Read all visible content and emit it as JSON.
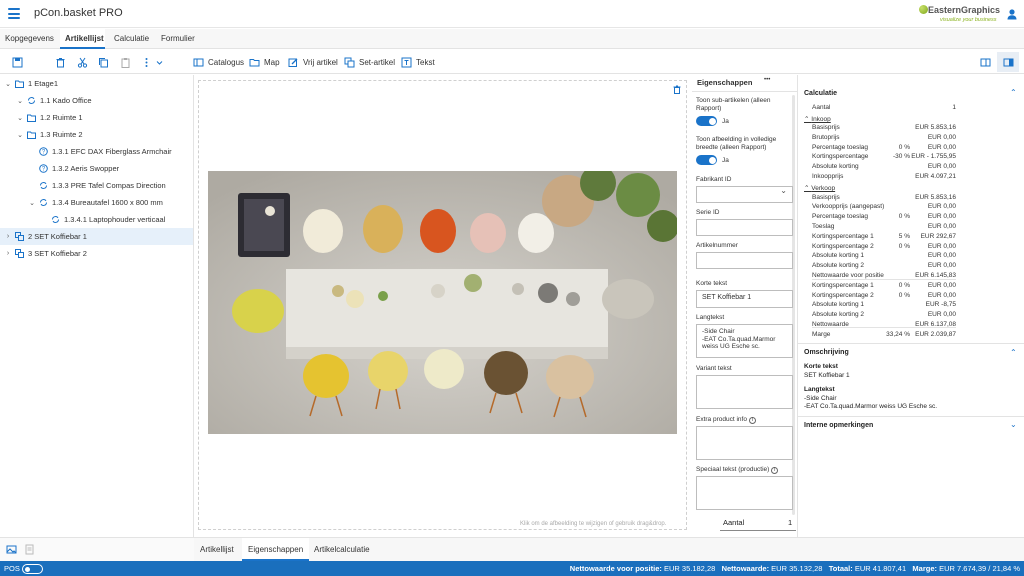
{
  "app": {
    "title": "pCon.basket PRO",
    "logo_brand": "EasternGraphics",
    "logo_tagline": "visualize your business"
  },
  "tabs": [
    "Kopgegevens",
    "Artikellijst",
    "Calculatie",
    "Formulier"
  ],
  "toolbar": {
    "catalogus": "Catalogus",
    "map": "Map",
    "vrij_artikel": "Vrij artikel",
    "set_artikel": "Set-artikel",
    "tekst": "Tekst"
  },
  "tree": [
    {
      "label": "1 Etage1"
    },
    {
      "label": "1.1 Kado Office"
    },
    {
      "label": "1.2 Ruimte 1"
    },
    {
      "label": "1.3 Ruimte 2"
    },
    {
      "label": "1.3.1 EFC DAX Fiberglass Armchair"
    },
    {
      "label": "1.3.2 Aeris Swopper"
    },
    {
      "label": "1.3.3 PRE Tafel Compas Direction"
    },
    {
      "label": "1.3.4 Bureautafel 1600 x 800 mm"
    },
    {
      "label": "1.3.4.1 Laptophouder verticaal"
    },
    {
      "label": "2 SET Koffiebar 1"
    },
    {
      "label": "3 SET Koffiebar 2"
    }
  ],
  "canvas": {
    "hint": "Klik om de afbeelding te wijzigen of gebruik drag&drop."
  },
  "props": {
    "tab_label": "Eigenschappen",
    "more": "•••",
    "toon_sub": "Toon sub-artikelen (alleen Rapport)",
    "toon_sub_val": "Ja",
    "toon_afb": "Toon afbeelding in volledige breedte (alleen Rapport)",
    "toon_afb_val": "Ja",
    "fabrikant": "Fabrikant ID",
    "serie": "Serie ID",
    "artikelnummer": "Artikelnummer",
    "korte_tekst": "Korte tekst",
    "korte_tekst_val": "SET Koffiebar 1",
    "langtekst": "Langtekst",
    "langtekst_l1": "-Side Chair",
    "langtekst_l2": "-EAT Co.Ta.quad.Marmor",
    "langtekst_l3": "weiss UG Esche sc.",
    "variant": "Variant tekst",
    "extra": "Extra product info",
    "speciaal": "Speciaal tekst (productie)",
    "aantal_label": "Aantal",
    "aantal_val": "1"
  },
  "calc": {
    "title": "Calculatie",
    "aantal": {
      "k": "Aantal",
      "v": "1"
    },
    "inkoop_hdr": "Inkoop",
    "inkoop": [
      {
        "k": "Basisprijs",
        "p": "",
        "v": "EUR 5.853,16"
      },
      {
        "k": "Brutoprijs",
        "p": "",
        "v": "EUR 0,00"
      },
      {
        "k": "Percentage toeslag",
        "p": "0 %",
        "v": "EUR 0,00"
      },
      {
        "k": "Kortingspercentage",
        "p": "-30 %",
        "v": "EUR - 1.755,95"
      },
      {
        "k": "Absolute korting",
        "p": "",
        "v": "EUR 0,00"
      },
      {
        "k": "Inkoopprijs",
        "p": "",
        "v": "EUR 4.097,21"
      }
    ],
    "verkoop_hdr": "Verkoop",
    "verkoop": [
      {
        "k": "Basisprijs",
        "p": "",
        "v": "EUR 5.853,16"
      },
      {
        "k": "Verkoopprijs (aangepast)",
        "p": "",
        "v": "EUR 0,00"
      },
      {
        "k": "Percentage toeslag",
        "p": "0 %",
        "v": "EUR 0,00"
      },
      {
        "k": "Toeslag",
        "p": "",
        "v": "EUR 0,00"
      },
      {
        "k": "Kortingspercentage 1",
        "p": "5 %",
        "v": "EUR 292,67"
      },
      {
        "k": "Kortingspercentage 2",
        "p": "0 %",
        "v": "EUR 0,00"
      },
      {
        "k": "Absolute korting 1",
        "p": "",
        "v": "EUR 0,00"
      },
      {
        "k": "Absolute korting 2",
        "p": "",
        "v": "EUR 0,00"
      },
      {
        "k": "Nettowaarde voor positie",
        "p": "",
        "v": "EUR 6.145,83"
      },
      {
        "k": "Kortingspercentage 1",
        "p": "0 %",
        "v": "EUR 0,00"
      },
      {
        "k": "Kortingspercentage 2",
        "p": "0 %",
        "v": "EUR 0,00"
      },
      {
        "k": "Absolute korting 1",
        "p": "",
        "v": "EUR -8,75"
      },
      {
        "k": "Absolute korting 2",
        "p": "",
        "v": "EUR 0,00"
      },
      {
        "k": "Nettowaarde",
        "p": "",
        "v": "EUR 6.137,08"
      },
      {
        "k": "Marge",
        "p": "33,24 %",
        "v": "EUR 2.039,87"
      }
    ],
    "omschrijving_title": "Omschrijving",
    "korte_tekst_hdr": "Korte tekst",
    "korte_tekst": "SET Koffiebar 1",
    "langtekst_hdr": "Langtekst",
    "langtekst_l1": "-Side Chair",
    "langtekst_l2": "-EAT Co.Ta.quad.Marmor weiss UG Esche sc.",
    "interne_title": "Interne opmerkingen"
  },
  "bottom_tabs": [
    "Artikellijst",
    "Eigenschappen",
    "Artikelcalculatie"
  ],
  "status": {
    "pos": "POS",
    "netto_pos_label": "Nettowaarde voor positie:",
    "netto_pos": "EUR 35.182,28",
    "netto_label": "Nettowaarde:",
    "netto": "EUR 35.132,28",
    "totaal_label": "Totaal:",
    "totaal": "EUR 41.807,41",
    "marge_label": "Marge:",
    "marge": "EUR 7.674,39 / 21,84 %"
  },
  "colors": {
    "accent": "#1a73c9",
    "statusbar": "#1a6fbd",
    "logo_green": "#8ab21e"
  }
}
